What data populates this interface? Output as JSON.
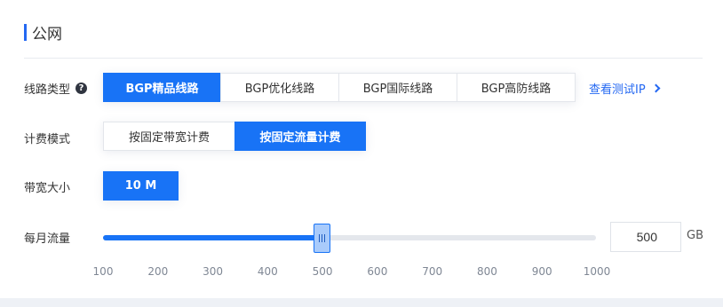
{
  "section": {
    "title": "公网"
  },
  "line_type": {
    "label": "线路类型",
    "help_glyph": "?",
    "options": [
      "BGP精品线路",
      "BGP优化线路",
      "BGP国际线路",
      "BGP高防线路"
    ],
    "selected": "BGP精品线路",
    "test_ip_link": "查看测试IP"
  },
  "billing": {
    "label": "计费模式",
    "options": [
      "按固定带宽计费",
      "按固定流量计费"
    ],
    "selected": "按固定流量计费"
  },
  "bandwidth": {
    "label": "带宽大小",
    "value": "10 M"
  },
  "monthly_traffic": {
    "label": "每月流量",
    "value": "500",
    "unit": "GB",
    "slider_min": 100,
    "slider_max": 1000,
    "slider_value": 500,
    "ticks": [
      "100",
      "200",
      "300",
      "400",
      "500",
      "600",
      "700",
      "800",
      "900",
      "1000"
    ]
  },
  "colors": {
    "accent": "#1873f6",
    "link": "#2468f2",
    "track": "#e4e7ec"
  },
  "icons": {
    "help": "help-circle-icon",
    "chevron": "chevron-right-icon",
    "grip": "slider-grip-icon"
  }
}
